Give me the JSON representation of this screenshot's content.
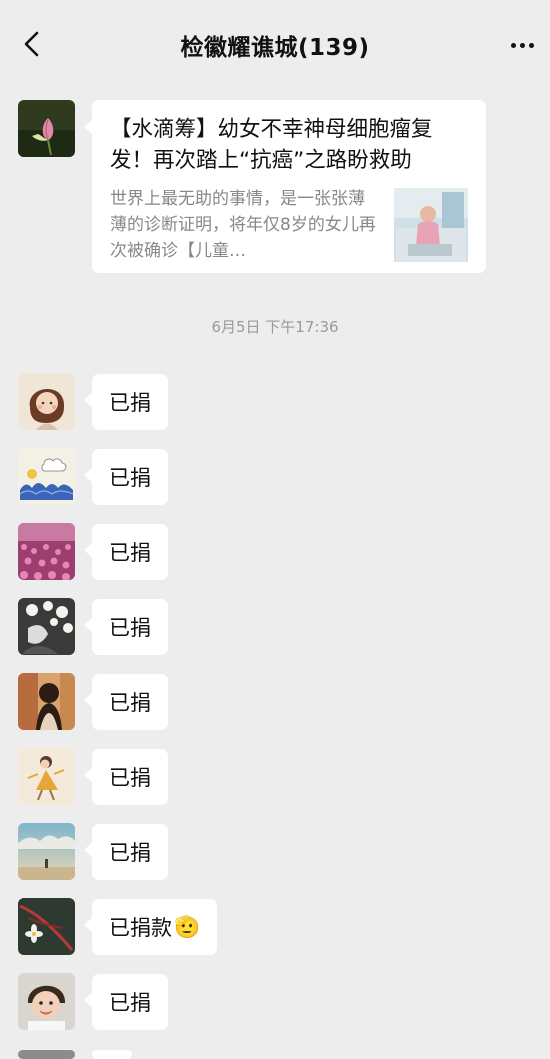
{
  "header": {
    "title": "检徽耀谯城(139)",
    "back_icon": "chevron-left-icon",
    "more_icon": "more-dots-icon"
  },
  "link_card": {
    "title": "【水滴筹】幼女不幸神母细胞瘤复发！再次踏上“抗癌”之路盼救助",
    "description": "世界上最无助的事情，是一张张薄薄的诊断证明，将年仅8岁的女儿再次被确诊【儿童…"
  },
  "timestamp": "6月5日 下午17:36",
  "messages": [
    {
      "text": "已捐"
    },
    {
      "text": "已捐"
    },
    {
      "text": "已捐"
    },
    {
      "text": "已捐"
    },
    {
      "text": "已捐"
    },
    {
      "text": "已捐"
    },
    {
      "text": "已捐"
    },
    {
      "text": "已捐款",
      "emoji": "🫡"
    },
    {
      "text": "已捐"
    }
  ]
}
